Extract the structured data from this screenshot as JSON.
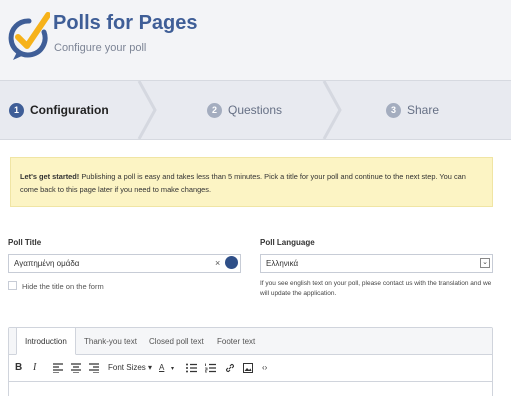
{
  "header": {
    "title": "Polls for Pages",
    "subtitle": "Configure your poll",
    "logo_icon": "check-bubble-icon",
    "colors": {
      "title": "#3f5e97",
      "logo_circle": "#3f5e97",
      "logo_check": "#f6b21a"
    }
  },
  "steps": [
    {
      "number": "1",
      "label": "Configuration",
      "state": "active"
    },
    {
      "number": "2",
      "label": "Questions",
      "state": "inactive"
    },
    {
      "number": "3",
      "label": "Share",
      "state": "inactive"
    }
  ],
  "notice": {
    "strong": "Let's get started!",
    "text": " Publishing a poll is easy and takes less than 5 minutes. Pick a title for your poll and continue to the next step. You can come back to this page later if you need to make changes."
  },
  "form": {
    "title_label": "Poll Title",
    "title_value": "Αγαπημένη ομάδα",
    "clear_symbol": "×",
    "hide_title_label": "Hide the title on the form",
    "language_label": "Poll Language",
    "language_value": "Ελληνικά",
    "language_caret": "⌄",
    "language_hint": "If you see english text on your poll, please contact us with the translation and we will update the application."
  },
  "editor": {
    "tabs": [
      "Introduction",
      "Thank-you text",
      "Closed poll text",
      "Footer text"
    ],
    "active_tab": "Introduction",
    "toolbar": {
      "bold": "B",
      "italic": "I",
      "font_sizes": "Font Sizes ▾",
      "text_color": "A",
      "text_color_caret": "▾",
      "code": "‹›",
      "icons": [
        "bold-icon",
        "italic-icon",
        "align-left-icon",
        "align-center-icon",
        "align-right-icon",
        "font-size-icon",
        "text-color-icon",
        "unordered-list-icon",
        "ordered-list-icon",
        "link-icon",
        "image-icon",
        "code-icon"
      ]
    }
  }
}
